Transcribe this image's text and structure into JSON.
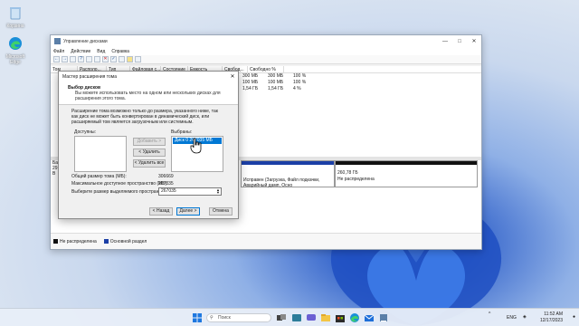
{
  "desktop": {
    "icons": [
      {
        "label": "Корзина"
      },
      {
        "label": "Microsoft Edge"
      }
    ]
  },
  "window": {
    "title": "Управление дисками",
    "menu": [
      "Файл",
      "Действие",
      "Вид",
      "Справка"
    ],
    "columns": [
      "Том",
      "Располо...",
      "Тип",
      "Файловая с...",
      "Состояние",
      "Емкость",
      "Свобод...",
      "Свободно %"
    ],
    "rows": [
      {
        "cap": "300 МБ",
        "free": "300 МБ",
        "pct": "100 %"
      },
      {
        "cap": "100 МБ",
        "free": "100 МБ",
        "pct": "100 %"
      },
      {
        "cap": "1,54 ГБ",
        "free": "1,54 ГБ",
        "pct": "4 %"
      }
    ],
    "disk_label_1": "Ба",
    "disk_label_2": "29",
    "disk_label_3": "В",
    "partition_text": "Исправен (Загрузка, Файл подкачки, Аварийный дамп, Осно",
    "unalloc_size": "260,78 ГБ",
    "unalloc_label": "Не распределена",
    "legend": [
      {
        "label": "Не распределена",
        "color": "#111111"
      },
      {
        "label": "Основной раздел",
        "color": "#1b3fa6"
      }
    ]
  },
  "dialog": {
    "title": "Мастер расширения тома",
    "header": "Выбор дисков",
    "subheader": "Вы можете использовать место на одном или нескольких дисках для расширения этого тома.",
    "description": "Расширение тома возможно только до размера, указанного ниже, так как диск не может быть конвертирован в динамический диск, или расширяемый том является загрузочным или системным.",
    "available_label": "Доступны:",
    "selected_label": "Выбраны:",
    "add_button": "Добавить >",
    "remove_button": "< Удалить",
    "remove_all_button": "< Удалить все",
    "selected_item": "Диск 0     267035 МБ",
    "total_label": "Общий размер тома (МБ):",
    "total_value": "306669",
    "max_label": "Максимальное доступное пространство (МБ):",
    "max_value": "267035",
    "choose_label": "Выберите размер выделяемого пространства (МБ):",
    "choose_value": "267035",
    "back_button": "< Назад",
    "next_button": "Далее >",
    "cancel_button": "Отмена"
  },
  "taskbar": {
    "search_placeholder": "Поиск",
    "lang": "ENG",
    "time": "11:52 AM",
    "date": "12/17/2023"
  },
  "colors": {
    "accent": "#0078d4",
    "primary_partition": "#1b3fa6",
    "unallocated": "#111111"
  }
}
